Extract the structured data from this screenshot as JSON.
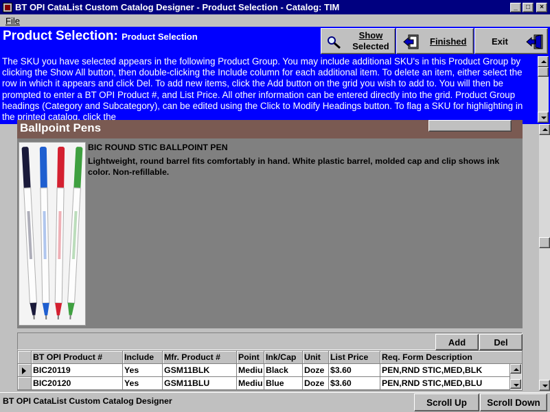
{
  "window": {
    "title": "BT OPI CataList Custom Catalog Designer - Product Selection - Catalog: TIM",
    "minimize": "_",
    "maximize": "□",
    "close": "×"
  },
  "menu": {
    "file": "File"
  },
  "header": {
    "title": "Product Selection:",
    "subtitle": "Product Selection",
    "show_line1": "Show",
    "show_line2": "Selected",
    "finished": "Finished",
    "exit": "Exit"
  },
  "info_text": "The SKU you have selected appears in the following Product Group.  You may include additional SKU's in this Product Group by clicking the Show All button, then double-clicking the Include column for each additional item.  To delete an item, either select the row in which it appears and click Del.  To add new items, click the Add button on the grid you wish to add to. You will then be prompted to enter a BT OPI Product #, and List Price.  All other information can be entered directly into the grid.  Product Group headings (Category and Subcategory), can be edited using the Click to Modify Headings button.  To flag a SKU for highlighting in the printed catalog, click the",
  "product_group": {
    "heading": "Ballpoint Pens",
    "name": "BIC ROUND STIC BALLPOINT PEN",
    "description": "Lightweight, round barrel fits comfortably in hand. White plastic barrel, molded cap and clip shows ink color. Non-refillable.",
    "pen_colors": [
      "#1a1a3a",
      "#1f5fd0",
      "#d42030",
      "#3fa040"
    ]
  },
  "grid": {
    "add": "Add",
    "del": "Del",
    "columns": [
      "BT OPI Product #",
      "Include",
      "Mfr. Product #",
      "Point",
      "Ink/Cap",
      "Unit",
      "List Price",
      "Req. Form Description"
    ],
    "rows": [
      [
        "BIC20119",
        "Yes",
        "GSM11BLK",
        "Mediu",
        "Black",
        "Doze",
        "$3.60",
        "PEN,RND STIC,MED,BLK"
      ],
      [
        "BIC20120",
        "Yes",
        "GSM11BLU",
        "Mediu",
        "Blue",
        "Doze",
        "$3.60",
        "PEN,RND STIC,MED,BLU"
      ]
    ]
  },
  "status": {
    "text": "BT OPI CataList Custom Catalog Designer",
    "scroll_up": "Scroll Up",
    "scroll_down": "Scroll Down"
  }
}
